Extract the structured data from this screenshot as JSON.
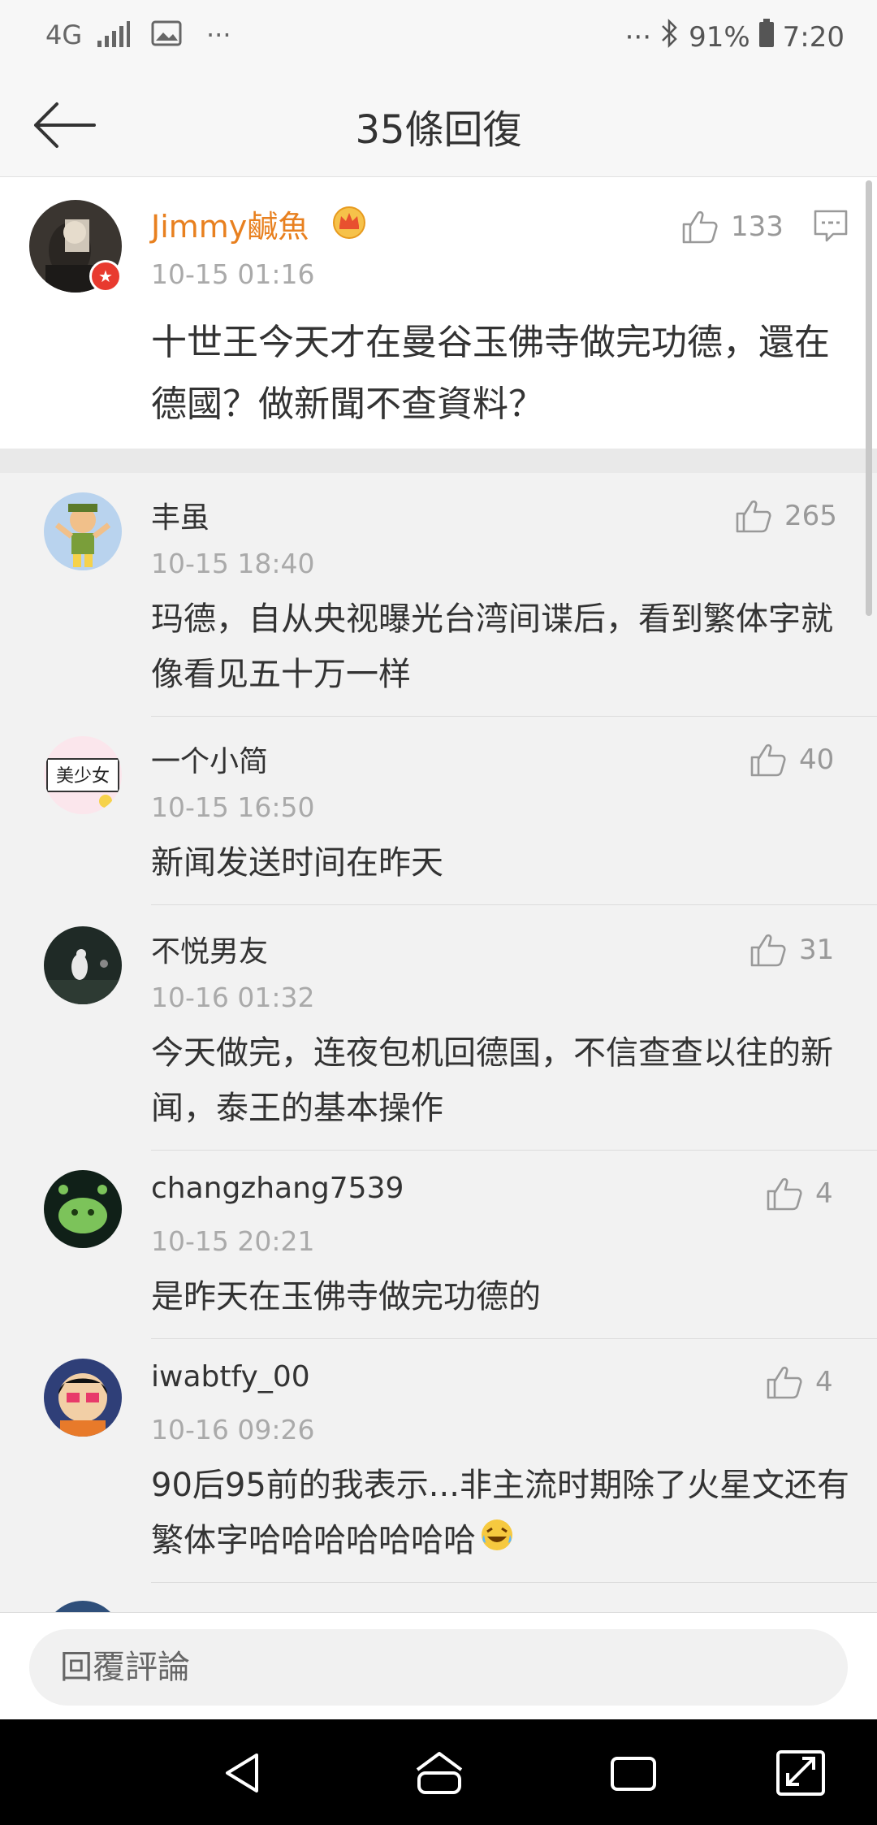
{
  "status_bar": {
    "network": "4G",
    "more_left": "···",
    "more_right": "···",
    "battery": "91%",
    "time": "7:20"
  },
  "header": {
    "title": "35條回復"
  },
  "main_comment": {
    "username": "Jimmy鹹魚",
    "time": "10-15 01:16",
    "text": "十世王今天才在曼谷玉佛寺做完功德，還在德國？做新聞不查資料？",
    "likes": "133"
  },
  "replies": [
    {
      "username": "丰虽",
      "time": "10-15 18:40",
      "text": "玛德，自从央视曝光台湾间谍后，看到繁体字就像看见五十万一样",
      "likes": "265"
    },
    {
      "username": "一个小简",
      "time": "10-15 16:50",
      "text": "新闻发送时间在昨天",
      "likes": "40",
      "avatar_text": "美少女"
    },
    {
      "username": "不悦男友",
      "time": "10-16 01:32",
      "text": "今天做完，连夜包机回德国，不信查查以往的新闻，泰王的基本操作",
      "likes": "31"
    },
    {
      "username": "changzhang7539",
      "time": "10-15 20:21",
      "text": "是昨天在玉佛寺做完功德的",
      "likes": "4"
    },
    {
      "username": "iwabtfy_00",
      "time": "10-16 09:26",
      "text": "90后95前的我表示...非主流时期除了火星文还有繁体字哈哈哈哈哈哈哈",
      "likes": "4"
    }
  ],
  "input": {
    "placeholder": "回覆評論"
  },
  "colors": {
    "accent_username": "#e8801f",
    "vip_badge": "#e83a2f"
  }
}
